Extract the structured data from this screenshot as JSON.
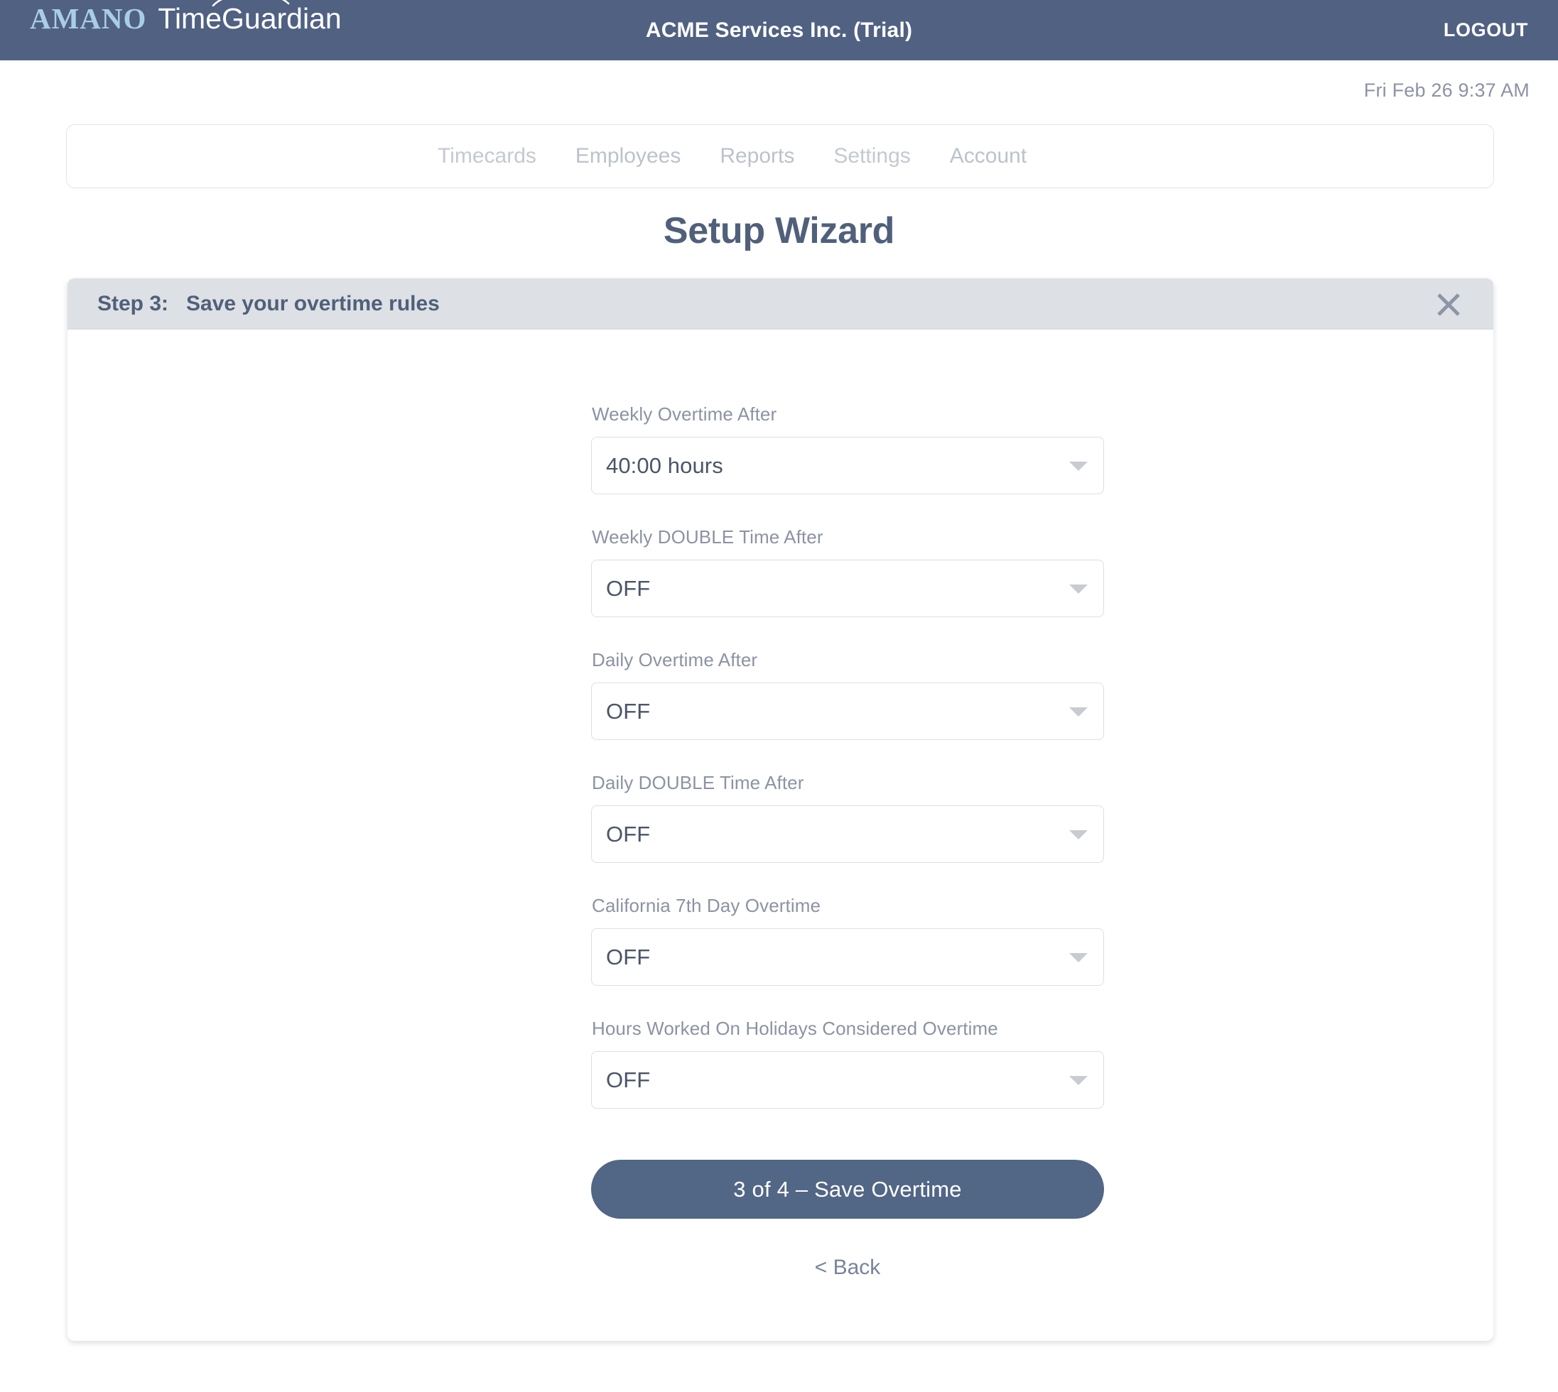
{
  "topbar": {
    "brand_primary": "AMANO",
    "brand_secondary": "TimeGuardian",
    "company": "ACME Services Inc. (Trial)",
    "logout_label": "LOGOUT",
    "background_color": "#506182",
    "brand_primary_color": "#a9cde8"
  },
  "datetime": "Fri Feb 26 9:37 AM",
  "nav": {
    "items": [
      {
        "label": "Timecards"
      },
      {
        "label": "Employees"
      },
      {
        "label": "Reports"
      },
      {
        "label": "Settings"
      },
      {
        "label": "Account"
      }
    ]
  },
  "page": {
    "title": "Setup Wizard",
    "title_color": "#50607a"
  },
  "card": {
    "header": {
      "step_label": "Step 3:",
      "step_title": "Save your overtime rules",
      "full_text": "Step 3:   Save your overtime rules",
      "close_icon": "close-icon",
      "background_color": "#dde0e5"
    },
    "form": {
      "fields": [
        {
          "label": "Weekly Overtime After",
          "value": "40:00 hours",
          "icon": "chevron-down-icon"
        },
        {
          "label": "Weekly DOUBLE Time After",
          "value": "OFF",
          "icon": "chevron-down-icon"
        },
        {
          "label": "Daily Overtime After",
          "value": "OFF",
          "icon": "chevron-down-icon"
        },
        {
          "label": "Daily DOUBLE Time After",
          "value": "OFF",
          "icon": "chevron-down-icon"
        },
        {
          "label": "California 7th Day Overtime",
          "value": "OFF",
          "icon": "chevron-down-icon"
        },
        {
          "label": "Hours Worked On Holidays Considered Overtime",
          "value": "OFF",
          "icon": "chevron-down-icon"
        }
      ],
      "submit_label": "3 of 4 – Save Overtime",
      "submit_color": "#526686",
      "back_label": "< Back"
    }
  }
}
